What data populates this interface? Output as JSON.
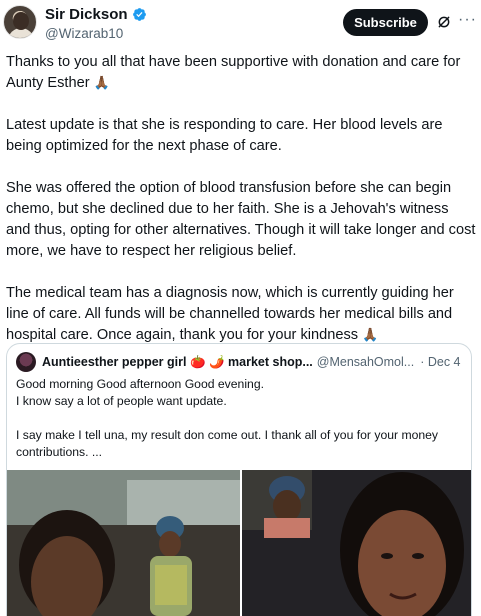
{
  "author": {
    "display_name": "Sir Dickson",
    "handle": "@Wizarab10",
    "verified": true
  },
  "actions": {
    "subscribe_label": "Subscribe",
    "grok_icon": "grok-icon",
    "more_icon": "more-icon"
  },
  "tweet": {
    "p1": "Thanks to you all that have been supportive with donation and care for Aunty Esther",
    "p2": "Latest update is that she is responding to care. Her blood levels are being optimized for the next phase of care.",
    "p3": "She was offered the option of blood transfusion before she can begin chemo, but she declined due to her faith. She is a Jehovah's witness and thus, opting for other alternatives. Though it will take longer and cost more, we have to respect her religious belief.",
    "p4": "The medical team has a diagnosis now, which is currently guiding her line of care. All funds will be channelled towards her medical bills and hospital care. Once again, thank you for your kindness",
    "emoji": "🙏🏾"
  },
  "quote": {
    "name": "Auntieesther pepper girl 🍅 🌶️ market shop...",
    "handle": "@MensahOmol...",
    "date": "· Dec 4",
    "line1": "Good morning Good afternoon Good evening.",
    "line2": "I know say a lot of people want update.",
    "line3": "I say make I tell una, my result don come out. I thank all of you for your money contributions. ..."
  },
  "colors": {
    "text": "#0f1419",
    "secondary": "#536471",
    "verified_blue": "#1d9bf0",
    "border": "#cfd9de"
  }
}
